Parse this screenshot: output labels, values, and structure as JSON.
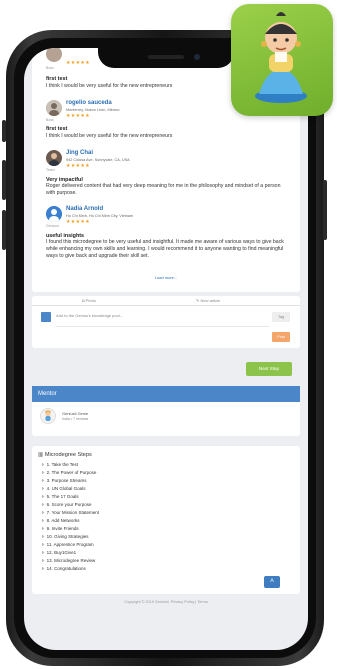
{
  "reviews": [
    {
      "name": "",
      "location": "",
      "stars": "★★★★★",
      "badge": "Boss",
      "title": "first test",
      "body": "I think I would be very useful for the new entrepreneurs"
    },
    {
      "name": "rogelio sauceda",
      "location": "Monterrey, Nuevo León, México",
      "stars": "★★★★★",
      "badge": "Boss",
      "title": "first test",
      "body": "I think I would be very useful for the new entrepreneurs"
    },
    {
      "name": "Jing Chai",
      "location": "942 Colusa Ave, Sunnyvale, CA, USA",
      "stars": "★★★★★",
      "badge": "Team",
      "title": "Very impactful",
      "body": "Roger delivered content that had very deep meaning for me in the philosophy and mindset of a person with purpose."
    },
    {
      "name": "Nadia Arnold",
      "location": "Ho Chi Minh, Ho Chi Minh City, Vietnam",
      "stars": "★★★★★",
      "badge": "Genious",
      "title": "useful insights",
      "body": "I found this microdegree to be very useful and insightful. It made me aware of various ways to give back while enhancing my own skills and learning. I would recommend it to anyone wanting to find meaningful ways to give back and upgrade their skill set."
    }
  ],
  "load_more": "Load more...",
  "post_tabs": {
    "photo": "Photo",
    "new_article": "New article"
  },
  "post": {
    "placeholder": "Add to the Genius's knowledge pool...",
    "tag_btn": "Tag",
    "post_btn": "Post"
  },
  "next_step": "Next Step",
  "mentor": {
    "header": "Mentor",
    "name": "Geniusli Genie",
    "meta": "India • 7 reviews"
  },
  "steps_title": "Microdegree Steps",
  "steps": [
    "1. Take the Test",
    "2. The Power of Purpose",
    "3. Purpose Streams",
    "4. UN Global Goals",
    "5. The 17 Goals",
    "6. Score your Purpose",
    "7. Your Mission Statement",
    "8. Add Networks",
    "9. Invite Friends",
    "10. Giving Strategies",
    "11. Apprentice Program",
    "12. Buy1Give1",
    "13. Microdegree Review",
    "14. Congratulations"
  ],
  "footer": "Copyright © 2019 Geniusli. Privacy Policy | Terms",
  "colors": {
    "accent": "#4a86c8",
    "green": "#8cc34a",
    "orange": "#f4a56a",
    "star": "#f0a020"
  }
}
